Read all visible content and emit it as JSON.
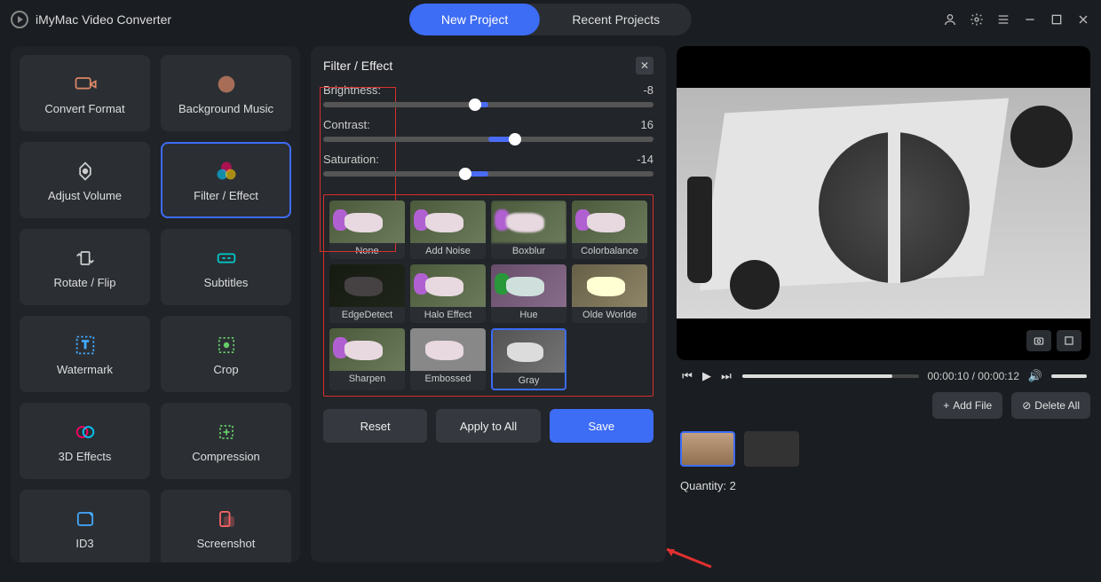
{
  "app": {
    "title": "iMyMac Video Converter"
  },
  "top_tabs": {
    "new_project": "New Project",
    "recent_projects": "Recent Projects"
  },
  "sidebar": {
    "items": [
      {
        "label": "Convert Format"
      },
      {
        "label": "Background Music"
      },
      {
        "label": "Adjust Volume"
      },
      {
        "label": "Filter / Effect"
      },
      {
        "label": "Rotate / Flip"
      },
      {
        "label": "Subtitles"
      },
      {
        "label": "Watermark"
      },
      {
        "label": "Crop"
      },
      {
        "label": "3D Effects"
      },
      {
        "label": "Compression"
      },
      {
        "label": "ID3"
      },
      {
        "label": "Screenshot"
      }
    ]
  },
  "panel": {
    "title": "Filter / Effect",
    "sliders": {
      "brightness_label": "Brightness:",
      "brightness_value": "-8",
      "contrast_label": "Contrast:",
      "contrast_value": "16",
      "saturation_label": "Saturation:",
      "saturation_value": "-14"
    },
    "effects": [
      "None",
      "Add Noise",
      "Boxblur",
      "Colorbalance",
      "EdgeDetect",
      "Halo Effect",
      "Hue",
      "Olde Worlde",
      "Sharpen",
      "Embossed",
      "Gray"
    ],
    "selected_effect": "Gray",
    "buttons": {
      "reset": "Reset",
      "apply_all": "Apply to All",
      "save": "Save"
    }
  },
  "preview": {
    "time_current": "00:00:10",
    "time_total": "00:00:12"
  },
  "file_bar": {
    "add": "Add File",
    "delete": "Delete All",
    "quantity_label": "Quantity:",
    "quantity_value": "2"
  },
  "colors": {
    "accent": "#3d6cf5",
    "highlight_red": "#d63030"
  }
}
